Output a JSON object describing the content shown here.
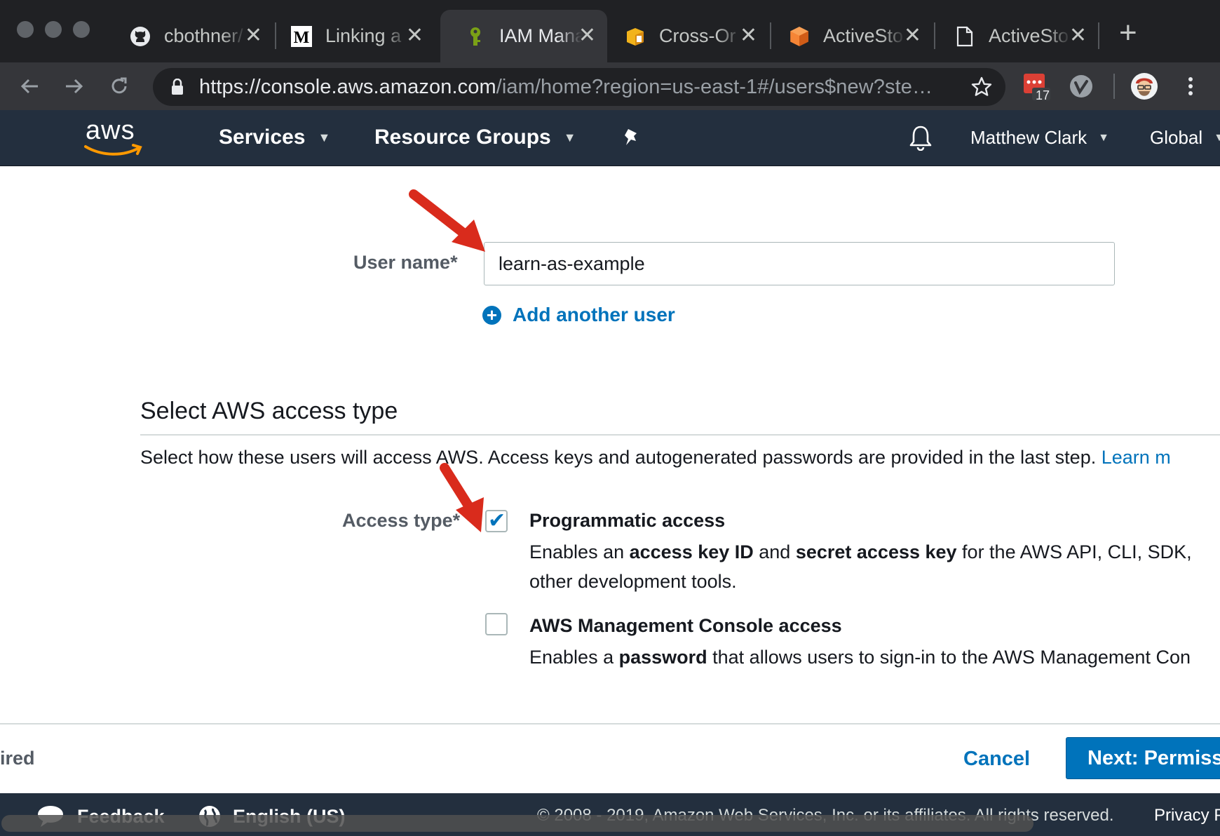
{
  "browser": {
    "tabs": [
      {
        "title": "cbothner/",
        "icon": "github-icon"
      },
      {
        "title": "Linking a",
        "icon": "medium-icon"
      },
      {
        "title": "IAM Mana",
        "icon": "iam-key-icon",
        "active": true
      },
      {
        "title": "Cross-Or",
        "icon": "aws-box-icon"
      },
      {
        "title": "ActiveSto",
        "icon": "aws-cube-icon"
      },
      {
        "title": "ActiveSto",
        "icon": "document-icon"
      }
    ],
    "close_glyph": "✕",
    "new_tab": "+",
    "url_host": "https://console.aws.amazon.com",
    "url_path": "/iam/home?region=us-east-1#/users$new?ste…",
    "extension_badge": "17"
  },
  "aws_nav": {
    "logo": "aws",
    "services": "Services",
    "resource_groups": "Resource Groups",
    "user": "Matthew Clark",
    "region": "Global"
  },
  "form": {
    "username_label": "User name*",
    "username_value": "learn-as-example",
    "add_user": "Add another user",
    "section_title": "Select AWS access type",
    "section_desc": "Select how these users will access AWS. Access keys and autogenerated passwords are provided in the last step.",
    "learn_more": "Learn m",
    "access_type_label": "Access type*",
    "options": [
      {
        "title": "Programmatic access",
        "checked": true,
        "desc_parts": [
          "Enables an ",
          "access key ID",
          " and ",
          "secret access key",
          " for the AWS API, CLI, SDK,"
        ],
        "desc_line2": "other development tools."
      },
      {
        "title": "AWS Management Console access",
        "checked": false,
        "desc_parts": [
          "Enables a ",
          "password",
          " that allows users to sign-in to the AWS Management Con"
        ]
      }
    ]
  },
  "actions": {
    "required": "ired",
    "cancel": "Cancel",
    "next": "Next: Permissi"
  },
  "footer": {
    "feedback": "Feedback",
    "language": "English (US)",
    "copyright": "© 2008 - 2019, Amazon Web Services, Inc. or its affiliates. All rights reserved.",
    "privacy": "Privacy P"
  },
  "colors": {
    "aws_nav": "#232f3e",
    "link": "#0073bb",
    "primary_button": "#0073bb",
    "annotation_arrow": "#d92b1c",
    "chrome_dark": "#202124"
  }
}
